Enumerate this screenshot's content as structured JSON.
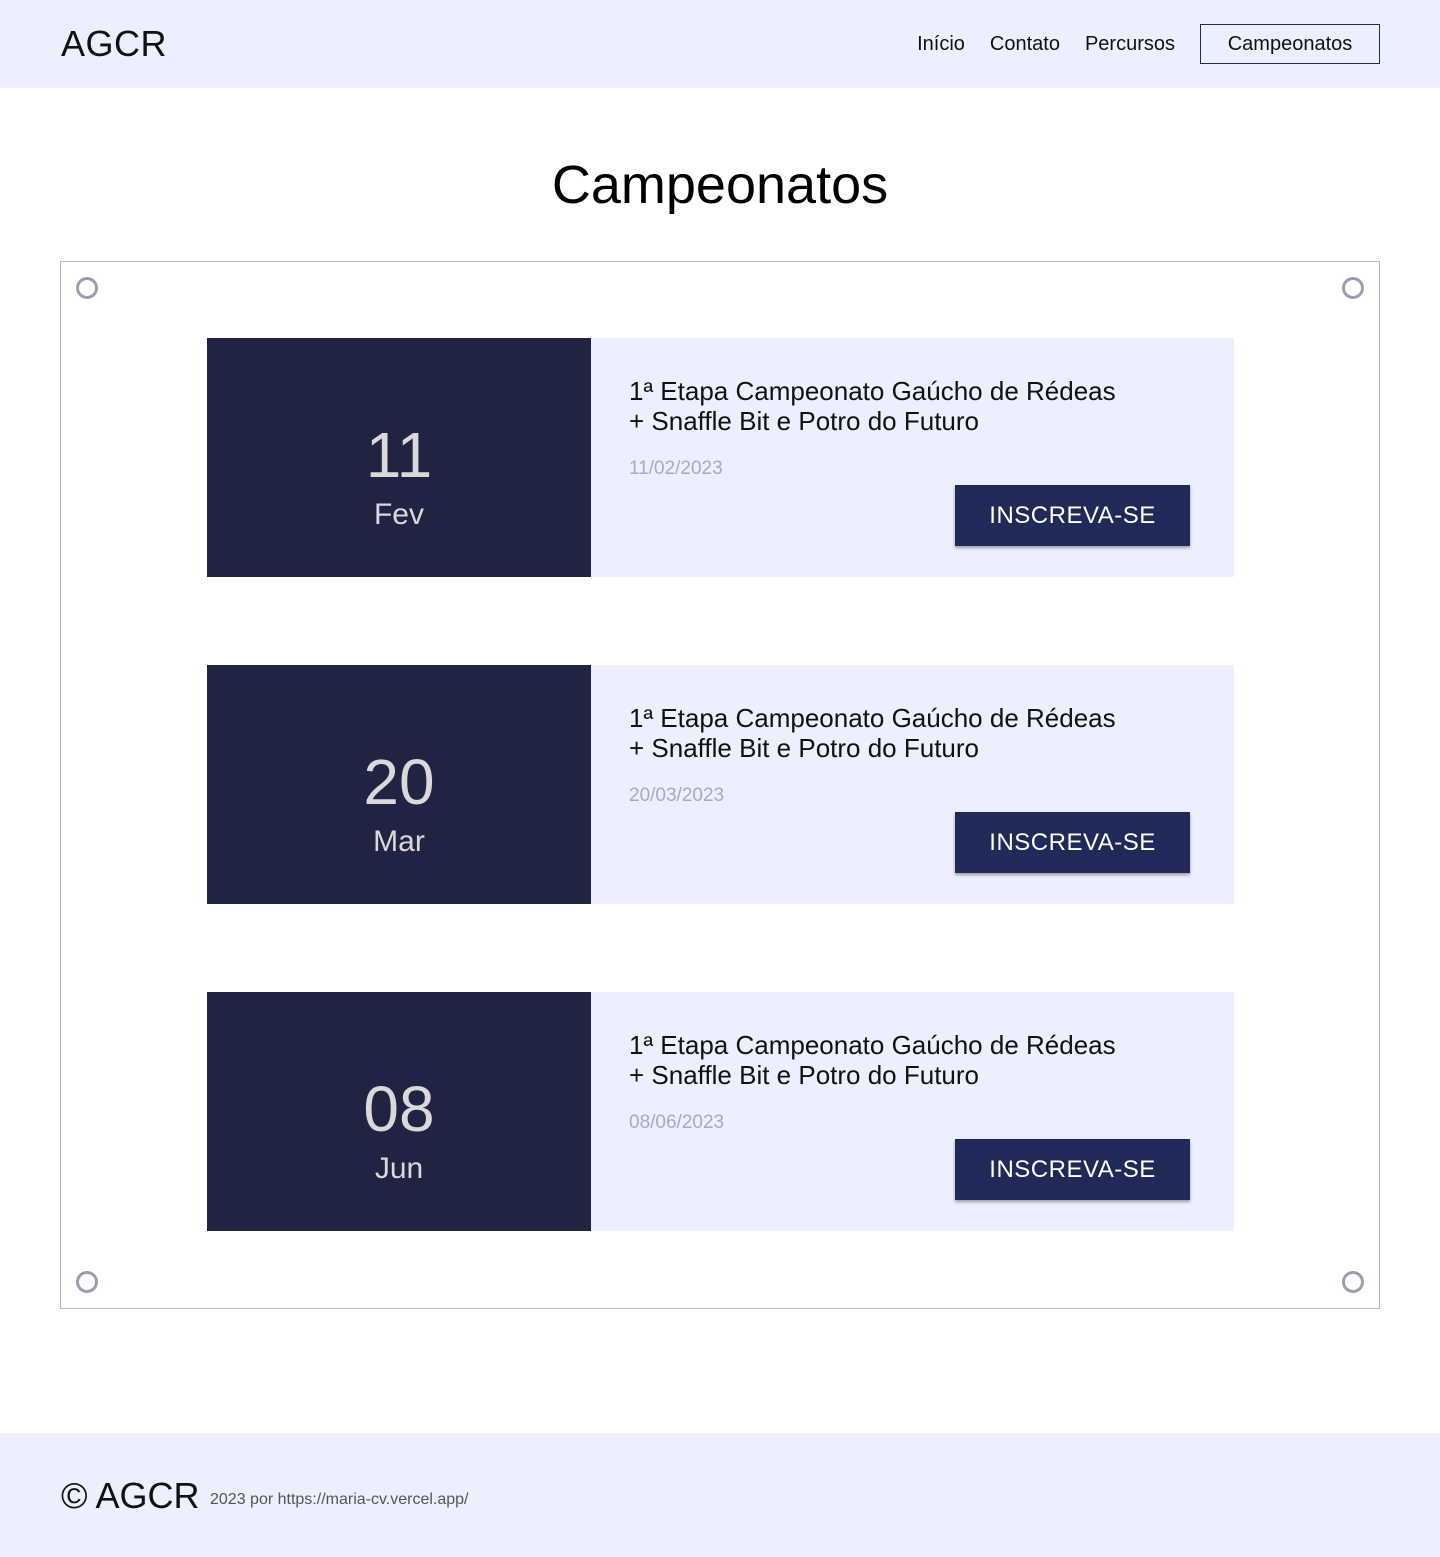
{
  "header": {
    "logo": "AGCR",
    "nav": [
      {
        "label": "Início"
      },
      {
        "label": "Contato"
      },
      {
        "label": "Percursos"
      },
      {
        "label": "Campeonatos"
      }
    ]
  },
  "main": {
    "title": "Campeonatos",
    "events": [
      {
        "day": "11",
        "month": "Fev",
        "title_line1": "1ª Etapa Campeonato Gaúcho de Rédeas",
        "title_line2": "+ Snaffle Bit e Potro do Futuro",
        "date": "11/02/2023",
        "button": "INSCREVA-SE"
      },
      {
        "day": "20",
        "month": "Mar",
        "title_line1": "1ª Etapa Campeonato Gaúcho de Rédeas",
        "title_line2": "+ Snaffle Bit e Potro do Futuro",
        "date": "20/03/2023",
        "button": "INSCREVA-SE"
      },
      {
        "day": "08",
        "month": "Jun",
        "title_line1": "1ª Etapa Campeonato Gaúcho de Rédeas",
        "title_line2": "+ Snaffle Bit e Potro do Futuro",
        "date": "08/06/2023",
        "button": "INSCREVA-SE"
      }
    ]
  },
  "footer": {
    "copyright": "© AGCR",
    "credit": "2023 por https://maria-cv.vercel.app/"
  },
  "colors": {
    "header_bg": "#eceffd",
    "date_panel_bg": "#212342",
    "button_bg": "#1f2a58",
    "date_text": "#a8aab8"
  }
}
